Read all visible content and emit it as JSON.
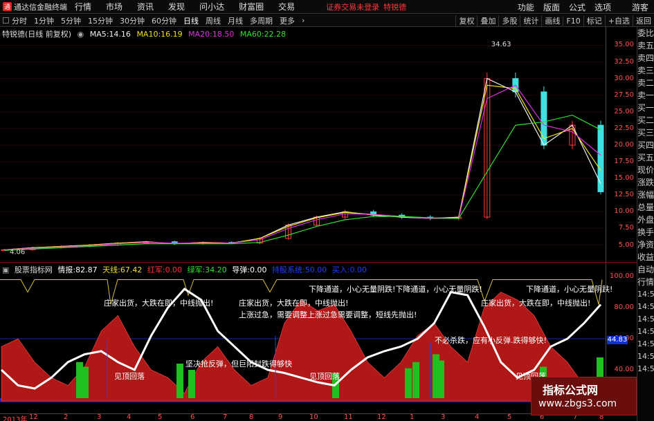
{
  "app": {
    "title": "通达信金融终端",
    "logo": "通",
    "warning": "证券交易未登录",
    "warning_user": "特锐德"
  },
  "menu": [
    "行情",
    "市场",
    "资讯",
    "发现",
    "问小达",
    "财富圈",
    "交易"
  ],
  "top_right": [
    "功能",
    "版面",
    "公式",
    "选项",
    "游客"
  ],
  "periods": [
    {
      "label": "分时",
      "active": false
    },
    {
      "label": "1分钟",
      "active": false
    },
    {
      "label": "5分钟",
      "active": false
    },
    {
      "label": "15分钟",
      "active": false
    },
    {
      "label": "30分钟",
      "active": false
    },
    {
      "label": "60分钟",
      "active": false
    },
    {
      "label": "日线",
      "active": true
    },
    {
      "label": "周线",
      "active": false
    },
    {
      "label": "月线",
      "active": false
    },
    {
      "label": "多周期",
      "active": false
    },
    {
      "label": "更多",
      "active": false
    }
  ],
  "toolbar": [
    "复权",
    "叠加",
    "多股",
    "统计",
    "画线",
    "F10",
    "标记",
    "+自选",
    "返回"
  ],
  "main": {
    "stock": "特锐德(日线 前复权)",
    "ma": [
      {
        "label": "MA5:",
        "value": "14.16",
        "color": "#f0f0f0"
      },
      {
        "label": "MA10:",
        "value": "16.19",
        "color": "#f0e020"
      },
      {
        "label": "MA20:",
        "value": "18.50",
        "color": "#e030e0"
      },
      {
        "label": "MA60:",
        "value": "22.28",
        "color": "#30e030"
      }
    ],
    "high_label": "34.63",
    "low_label": "4.06",
    "price_ticks": [
      "35.00",
      "32.50",
      "30.00",
      "27.50",
      "25.00",
      "22.50",
      "20.00",
      "17.50",
      "15.00",
      "12.50",
      "10.00",
      "7.50",
      "5.00"
    ]
  },
  "indicator": {
    "name": "股票指标网",
    "params": [
      {
        "label": "情报:",
        "value": "82.87",
        "color": "#ffffff"
      },
      {
        "label": "天线:",
        "value": "67.42",
        "color": "#f0e020"
      },
      {
        "label": "红军:",
        "value": "0.00",
        "color": "#ff3030"
      },
      {
        "label": "绿军:",
        "value": "34.20",
        "color": "#30e030"
      },
      {
        "label": "导弹:",
        "value": "0.00",
        "color": "#ffffff"
      },
      {
        "label": "持股系统:",
        "value": "50.00",
        "color": "#2040ff"
      },
      {
        "label": "买入:",
        "value": "0.00",
        "color": "#2040ff"
      }
    ],
    "ticks": [
      "100.00",
      "80.00",
      "60.00",
      "40.00"
    ],
    "current": "44.83",
    "annotations": [
      "庄家出货，大跌在即，中线抛出!",
      "庄家出货，大跌在即，中线抛出!",
      "庄家出货，大跌在即，中线抛出!",
      "下降通道，小心无量阴跌!下降通道，小心无量阴跌!",
      "下降通道，小心无量阴跌!",
      "上涨过急，需要调整上涨过急需要调整，短线先抛出!",
      "不必杀跌，应有小反弹.跌得够快!",
      "坚决抢反弹，但巨阳封跌得够快",
      "见顶回落",
      "见顶回落",
      "见顶回落"
    ]
  },
  "side_tabs": [
    "委比",
    "卖五",
    "卖四",
    "卖三",
    "卖二",
    "卖一",
    "买一",
    "买二",
    "买三",
    "买四",
    "买五",
    "现价",
    "涨跌",
    "涨幅",
    "总量",
    "外盘",
    "换手",
    "净资",
    "收益"
  ],
  "side_tabs_lower": [
    "自动",
    "行情"
  ],
  "side_times": [
    "14:50",
    "14:50",
    "14:50",
    "14:50",
    "14:50",
    "14:50",
    "14:50"
  ],
  "dates": [
    "2013年",
    "12",
    "2",
    "3",
    "4",
    "5",
    "6",
    "7",
    "8",
    "9",
    "10",
    "11",
    "12",
    "1",
    "3",
    "4",
    "5",
    "6",
    "7",
    "8"
  ],
  "watermark": {
    "title": "指标公式网",
    "url": "www.zbgs3.com"
  },
  "chart_data": [
    {
      "type": "candlestick",
      "title": "特锐德(日线 前复权)",
      "ylim": [
        3.5,
        36.5
      ],
      "x": [
        "2013-11",
        "2013-12",
        "2014-01",
        "2014-02",
        "2014-03",
        "2014-04",
        "2014-05",
        "2014-06",
        "2014-07",
        "2014-08",
        "2014-09",
        "2014-10",
        "2014-11",
        "2014-12",
        "2015-01",
        "2015-02",
        "2015-03",
        "2015-04",
        "2015-05",
        "2015-06",
        "2015-07",
        "2015-08"
      ],
      "close": [
        4.3,
        4.6,
        4.8,
        5.0,
        5.3,
        5.5,
        5.2,
        5.4,
        5.3,
        6.0,
        8.0,
        9.2,
        10.0,
        9.5,
        9.2,
        9.0,
        9.2,
        30.0,
        28.0,
        20.0,
        23.0,
        13.0
      ],
      "series": [
        {
          "name": "MA5",
          "values": [
            4.3,
            4.6,
            4.8,
            5.0,
            5.3,
            5.5,
            5.2,
            5.4,
            5.3,
            6.0,
            8.0,
            9.2,
            10.0,
            9.5,
            9.2,
            9.0,
            9.2,
            30.0,
            28.0,
            20.0,
            23.0,
            14.2
          ]
        },
        {
          "name": "MA10",
          "values": [
            4.3,
            4.6,
            4.8,
            5.0,
            5.3,
            5.5,
            5.2,
            5.4,
            5.3,
            6.0,
            7.8,
            9.1,
            9.9,
            9.6,
            9.3,
            9.0,
            9.1,
            29.0,
            28.5,
            21.0,
            22.5,
            16.2
          ]
        },
        {
          "name": "MA20",
          "values": [
            4.3,
            4.5,
            4.7,
            4.9,
            5.2,
            5.4,
            5.3,
            5.3,
            5.3,
            5.8,
            7.5,
            8.8,
            9.7,
            9.6,
            9.3,
            9.0,
            9.0,
            27.0,
            29.0,
            23.0,
            22.0,
            18.5
          ]
        },
        {
          "name": "MA60",
          "values": [
            4.2,
            4.4,
            4.6,
            4.8,
            5.0,
            5.2,
            5.2,
            5.2,
            5.2,
            5.4,
            6.5,
            7.8,
            8.8,
            9.3,
            9.3,
            9.1,
            9.0,
            16.0,
            23.0,
            23.5,
            24.5,
            22.3
          ]
        }
      ]
    },
    {
      "type": "area",
      "title": "股票指标网",
      "ylim": [
        20,
        100
      ],
      "series": [
        {
          "name": "情报",
          "values": [
            40,
            30,
            28,
            35,
            45,
            50,
            52,
            45,
            40,
            62,
            80,
            92,
            85,
            65,
            55,
            45,
            40,
            38,
            35,
            32,
            30,
            40,
            48,
            52,
            55,
            60,
            70,
            90,
            88,
            68,
            45,
            35,
            40,
            55,
            60,
            70,
            82
          ]
        },
        {
          "name": "红军",
          "values": [
            55,
            60,
            45,
            35,
            30,
            42,
            65,
            75,
            55,
            40,
            35,
            25,
            45,
            55,
            40,
            30,
            35,
            70,
            85,
            78,
            82,
            65,
            45,
            35,
            45,
            62,
            70,
            55,
            45,
            80,
            90,
            85,
            75,
            55,
            45,
            30,
            25
          ]
        }
      ]
    }
  ]
}
